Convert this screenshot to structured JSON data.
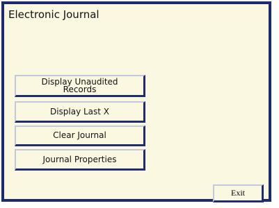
{
  "window": {
    "title": "Electronic Journal"
  },
  "menu": {
    "display_unaudited_line1": "Display Unaudited",
    "display_unaudited_line2": "Records",
    "display_last_x": "Display Last X",
    "clear_journal": "Clear Journal",
    "journal_properties": "Journal Properties"
  },
  "footer": {
    "exit_label": "Exit"
  },
  "colors": {
    "background": "#fbf8e2",
    "frame": "#1c2a6e",
    "button_shadow": "#1f2c72",
    "button_highlight": "#c5c8dc"
  }
}
